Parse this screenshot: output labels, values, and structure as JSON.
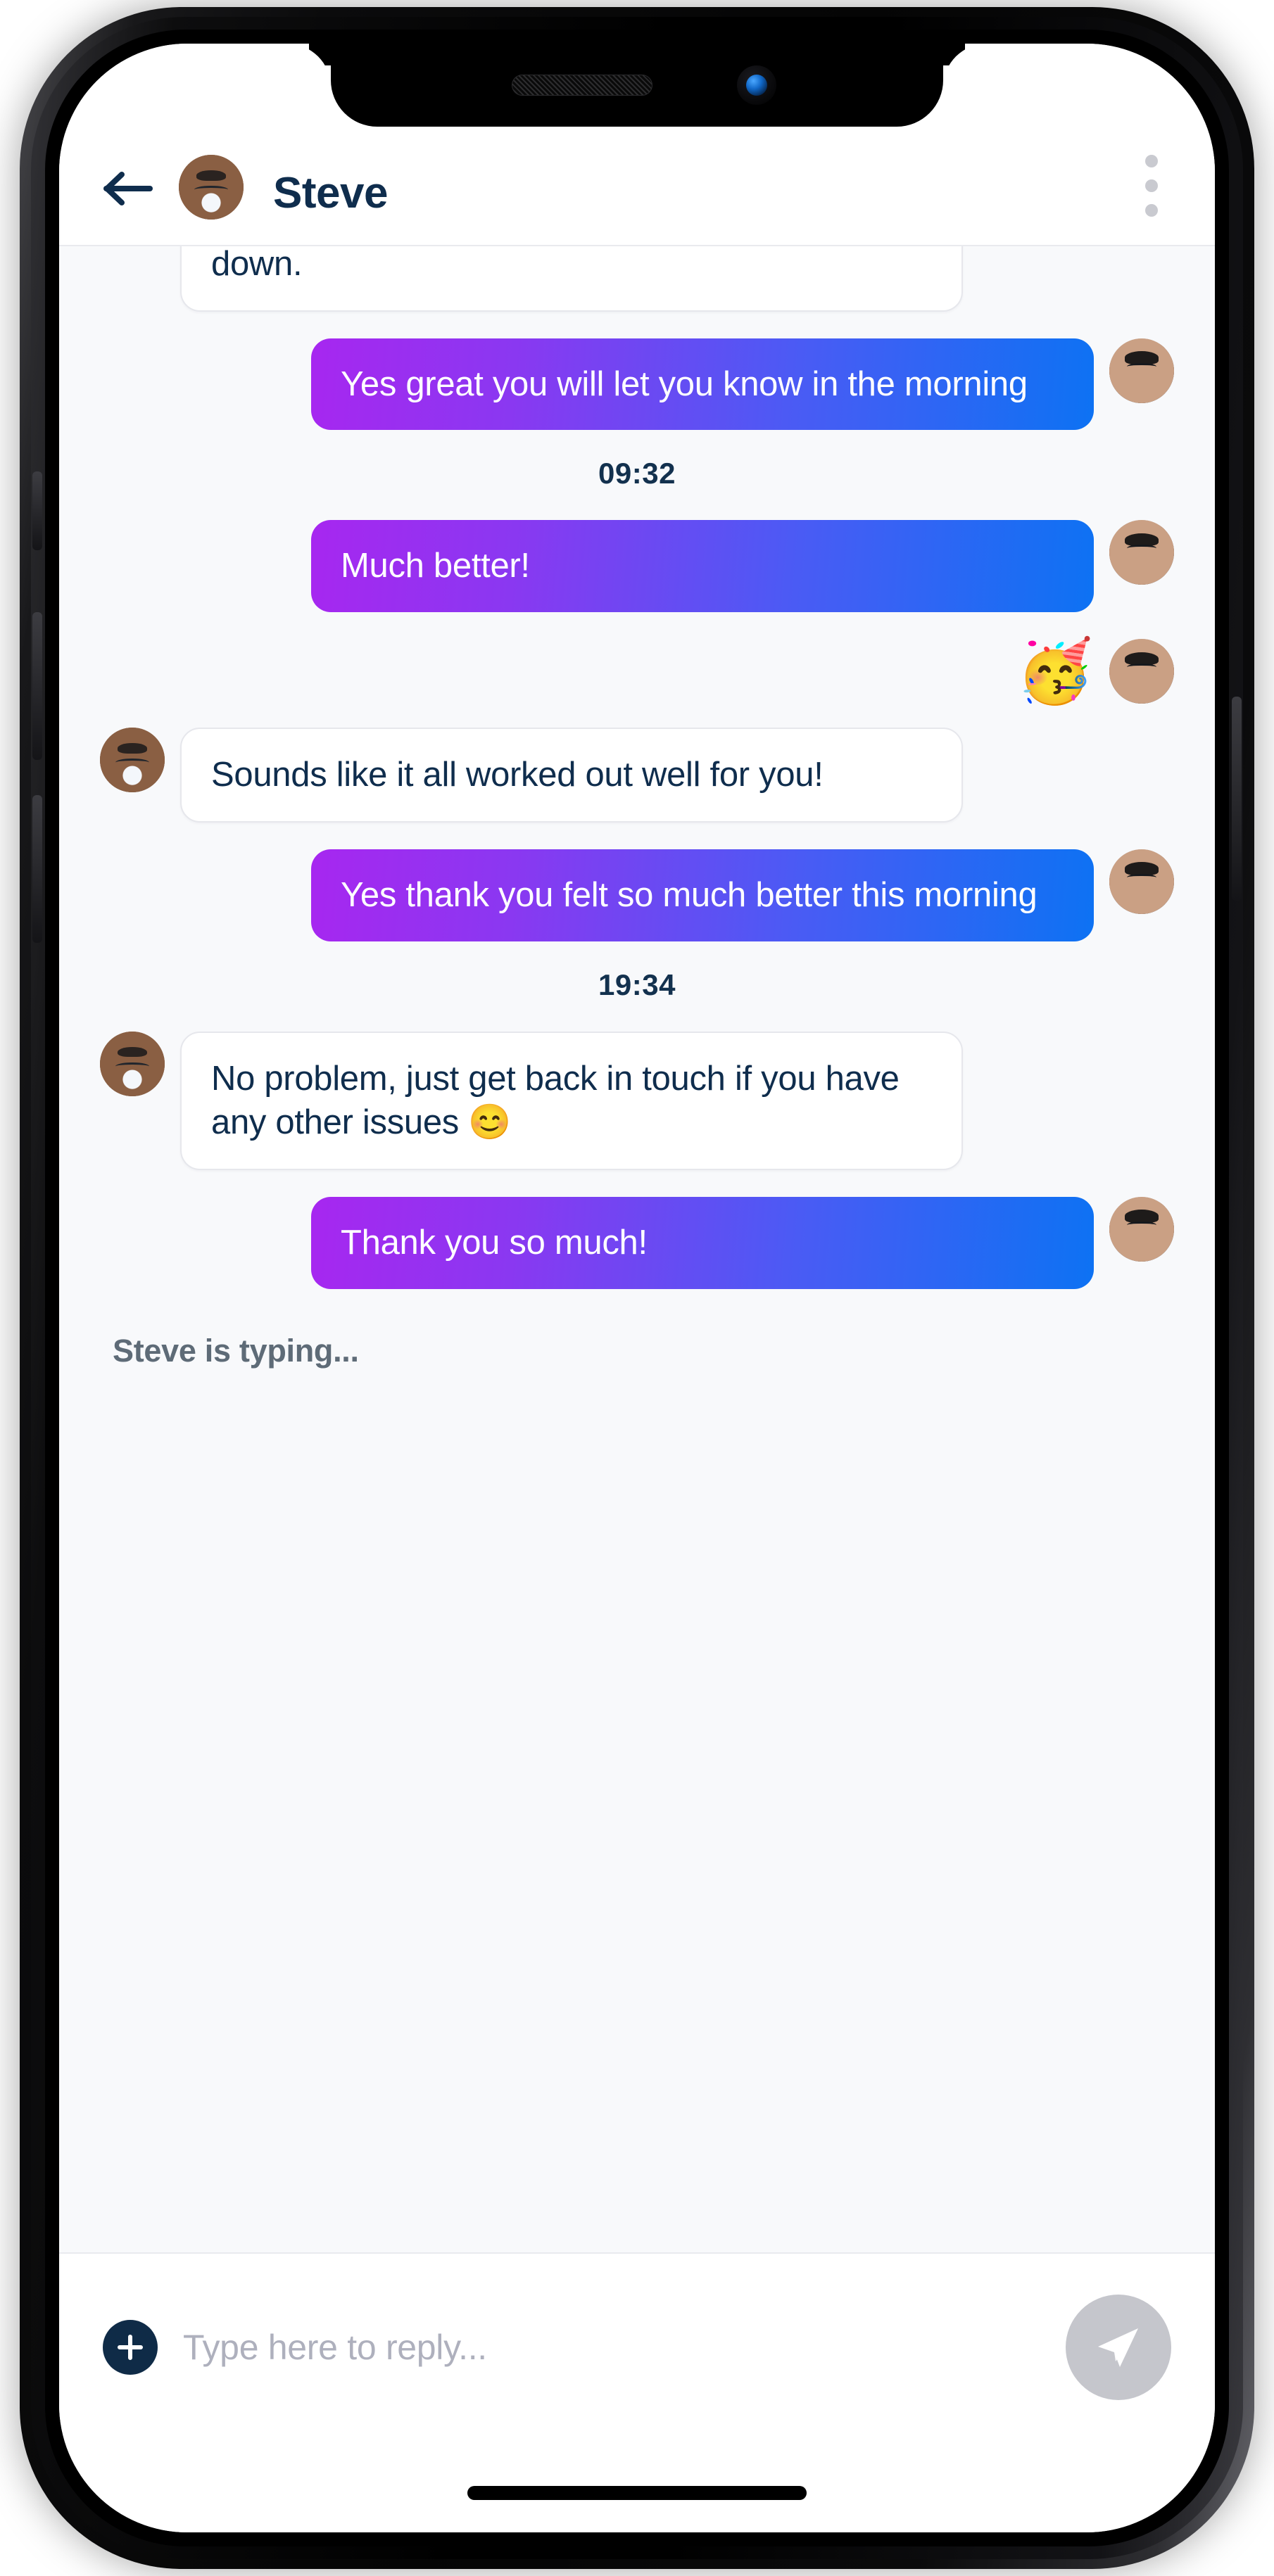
{
  "device": {
    "notch": {
      "speaker": "speaker-grille",
      "camera": "front-camera"
    },
    "home_indicator": "home-indicator"
  },
  "header": {
    "back_icon": "back-arrow-icon",
    "avatar_alt": "Steve avatar",
    "title": "Steve",
    "menu_icon": "overflow-menu-icon"
  },
  "colors": {
    "bubble_gradient_start": "#A727F0",
    "bubble_gradient_end": "#0D72F3",
    "incoming_bubble_bg": "#FFFFFF",
    "incoming_bubble_border": "#E6E7EC",
    "text_dark_navy": "#0F2D4D",
    "chat_background": "#F8F9FB",
    "typing_text": "#5E6B77",
    "menu_dots": "#C9CAD0",
    "send_button_bg": "#C5C6CC",
    "plus_button_bg": "#0F2B47",
    "placeholder": "#AEB0BD"
  },
  "conversation": [
    {
      "kind": "message",
      "side": "in",
      "text": "down.",
      "clipped": true,
      "avatar": "none"
    },
    {
      "kind": "message",
      "side": "out",
      "text": "Yes great you will let you know in the morning",
      "avatar": "user"
    },
    {
      "kind": "timestamp",
      "text": "09:32"
    },
    {
      "kind": "message",
      "side": "out",
      "text": "Much better!",
      "avatar": "user"
    },
    {
      "kind": "reaction",
      "emoji": "🥳",
      "emoji_name": "partying-face-emoji",
      "avatar": "user"
    },
    {
      "kind": "message",
      "side": "in",
      "text": "Sounds like it all worked out well for you!",
      "avatar": "steve"
    },
    {
      "kind": "message",
      "side": "out",
      "text": "Yes thank you felt so much better this morning",
      "avatar": "user"
    },
    {
      "kind": "timestamp",
      "text": "19:34"
    },
    {
      "kind": "message",
      "side": "in",
      "text": "No problem, just get back in touch if you have any other issues 😊",
      "avatar": "steve"
    },
    {
      "kind": "message",
      "side": "out",
      "text": "Thank you so much!",
      "avatar": "user"
    }
  ],
  "typing": {
    "text": "Steve is typing..."
  },
  "composer": {
    "plus_label": "+",
    "input_value": "",
    "input_placeholder": "Type here to reply...",
    "send_icon": "send-paper-plane-icon"
  }
}
